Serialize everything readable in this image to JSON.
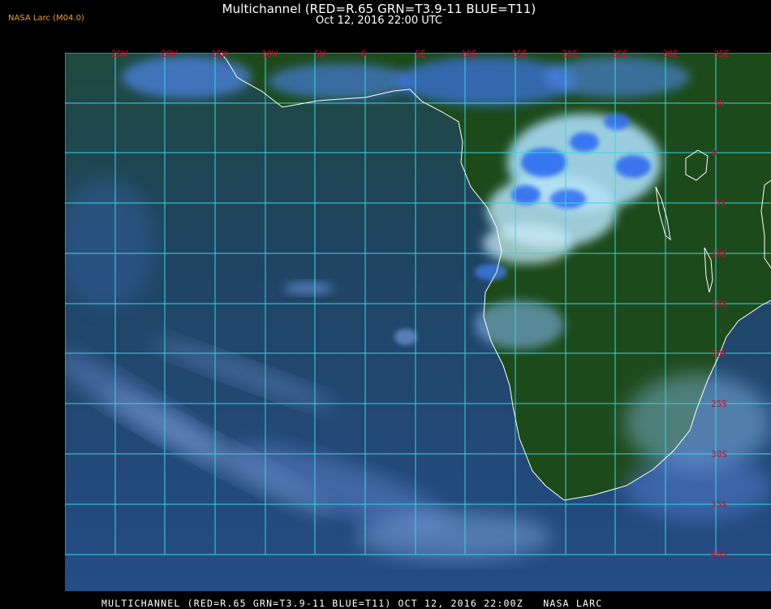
{
  "header": {
    "title": "Multichannel (RED=R.65 GRN=T3.9-11 BLUE=T11)",
    "subtitle": "Oct 12, 2016 22:00 UTC"
  },
  "source_label": "NASA Larc (M04.0)",
  "footer": "MULTICHANNEL (RED=R.65 GRN=T3.9-11 BLUE=T11) OCT 12, 2016 22:00Z   NASA LARC",
  "map": {
    "region": "Southern and Central Africa with adjacent Atlantic Ocean",
    "longitude_labels": [
      "25W",
      "20W",
      "15W",
      "10W",
      "5W",
      "0",
      "5E",
      "10E",
      "15E",
      "20E",
      "25E",
      "30E",
      "35E"
    ],
    "latitude_labels": [
      "5N",
      "0",
      "5S",
      "10S",
      "15S",
      "20S",
      "25S",
      "30S",
      "35S",
      "40S"
    ],
    "colors": {
      "grid": "#35d6e6",
      "tick_labels": "#c8102e",
      "coastline": "#ffffff",
      "land": "#1f4a1c",
      "ocean": "#1f3f6a",
      "cloud_bright": "#bfe6ff",
      "cloud_cold": "#2f6cf0",
      "source_label": "#e8a23a"
    }
  }
}
